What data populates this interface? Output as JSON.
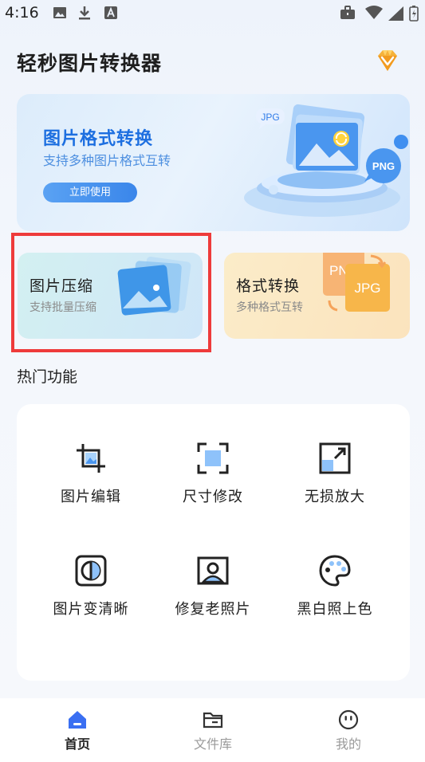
{
  "status_bar": {
    "time": "4:16"
  },
  "header": {
    "title": "轻秒图片转换器"
  },
  "banner": {
    "title": "图片格式转换",
    "subtitle": "支持多种图片格式互转",
    "button_label": "立即使用",
    "art_tags": [
      "JPG",
      "PNG"
    ]
  },
  "cards": [
    {
      "title": "图片压缩",
      "subtitle": "支持批量压缩"
    },
    {
      "title": "格式转换",
      "subtitle": "多种格式互转",
      "art_tags": [
        "PN",
        "JPG"
      ]
    }
  ],
  "hot": {
    "title": "热门功能",
    "items": [
      {
        "label": "图片编辑",
        "icon": "crop-icon"
      },
      {
        "label": "尺寸修改",
        "icon": "resize-frame-icon"
      },
      {
        "label": "无损放大",
        "icon": "enlarge-icon"
      },
      {
        "label": "图片变清晰",
        "icon": "sharpen-icon"
      },
      {
        "label": "修复老照片",
        "icon": "portrait-icon"
      },
      {
        "label": "黑白照上色",
        "icon": "palette-icon"
      }
    ]
  },
  "nav": [
    {
      "label": "首页",
      "icon": "home-icon",
      "active": true
    },
    {
      "label": "文件库",
      "icon": "folder-icon",
      "active": false
    },
    {
      "label": "我的",
      "icon": "smile-icon",
      "active": false
    }
  ],
  "colors": {
    "accent": "#3a86ea",
    "highlight": "#ee3b3b",
    "nav_active": "#3a6ff2"
  }
}
